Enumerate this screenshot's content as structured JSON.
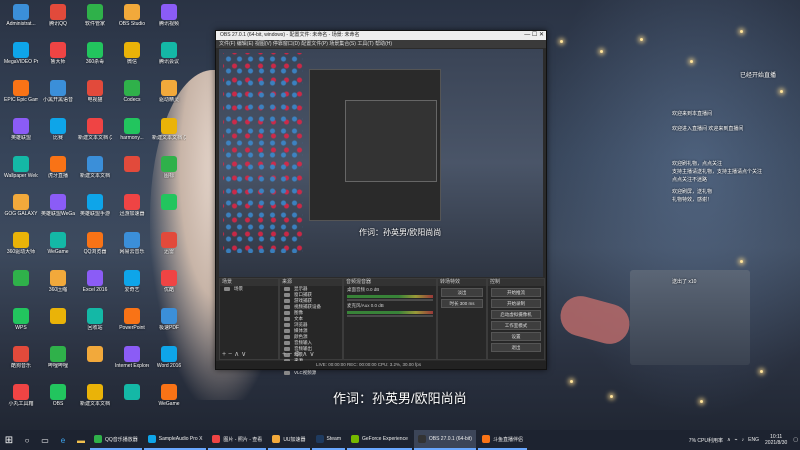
{
  "desktop_icons": [
    "Administrat...",
    "腾讯QQ",
    "软件管家",
    "OBS Studio",
    "腾讯视频",
    "MegaVIDEO Pro",
    "鲁大师",
    "360杀毒",
    "微信",
    "腾讯会议",
    "EPIC Epic Games Launcher",
    "小黑开黑语音",
    "电视猫",
    "Codecs",
    "驱动精灵",
    "英雄联盟",
    "比赛",
    "新建文本文档 (2).txt",
    "harmony...",
    "新建文本文档 (3).txt",
    "Wallpaper Welcome",
    "虎牙直播",
    "新建文本文档",
    "",
    "图标",
    "GOG GALAXY",
    "英雄联盟WeGame",
    "英雄联盟手游",
    "迅游加速器",
    "",
    "360驱动大师",
    "WeGame",
    "QQ浏览器",
    "网易云音乐",
    "迅雷",
    "",
    "360压缩",
    "Excel 2016",
    "爱奇艺",
    "优酷",
    "WPS",
    "",
    "回收站",
    "PowerPoint",
    "极速PDF",
    "酷狗音乐",
    "哔哩哔哩",
    "",
    "Internet Explorer",
    "Word 2016",
    "小丸工具箱",
    "OBS",
    "新建文本文档",
    "",
    "WeGame",
    "WPS Office",
    "迅游",
    "网易UU加速器",
    "",
    "斗鱼直播",
    "红色警戒",
    "Steam",
    "剪映",
    "Unity Connect",
    "斗鱼直播伴侣",
    "新建文件夹",
    "钉钉",
    "新建文件",
    "Launcher",
    "爱奇艺",
    "百度网盘",
    "GameViewer",
    "新建文本文档",
    "新建文本文档"
  ],
  "obs": {
    "title": "OBS 27.0.1 (64-bit, windows) - 配置文件: 未命名 - 场景: 未命名",
    "menu": "文件(F)   编辑(E)   视图(V)   停靠窗口(D)   配置文件(P)   场景集合(S)   工具(T)   帮助(H)",
    "lyric_preview": "作词：孙英男/欧阳尚尚",
    "docks": {
      "scenes": {
        "title": "场景",
        "items": [
          "场景"
        ]
      },
      "sources": {
        "title": "来源",
        "items": [
          "显示器",
          "窗口捕获",
          "游戏捕获",
          "视频捕获设备",
          "图像",
          "文本",
          "浏览器",
          "媒体源",
          "颜色源",
          "音频输入",
          "音频输出",
          "场景",
          "来源",
          "图像幻灯片",
          "VLC视频源"
        ]
      },
      "mixer": {
        "title": "音频混音器",
        "items": [
          "桌面音频 0.0 dB",
          "麦克风/Aux 0.0 dB"
        ]
      },
      "transitions": {
        "title": "转场特效",
        "items": [
          "淡出",
          "时长 300 ms"
        ]
      },
      "controls": {
        "title": "控制",
        "items": [
          "开始推流",
          "开始录制",
          "启动虚拟摄像机",
          "工作室模式",
          "设置",
          "退出"
        ]
      }
    },
    "status": "LIVE: 00:00:00   REC: 00:00:00   CPU: 3.2%, 30.00 fps"
  },
  "right_panel": {
    "header": "已经开始直播",
    "lines": [
      "欢迎来到本直播间",
      "欢迎进入直播间 欢迎来到直播间",
      "欢迎刷礼物，点点关注",
      "支持主播请送礼物，支持主播请点个关注",
      "点点关注不迷路",
      "欢迎刷屏，送礼物",
      "礼物特效，感谢！",
      "送出了 x10"
    ]
  },
  "lyric": "作词：孙英男/欧阳尚尚",
  "taskbar": {
    "apps": [
      "QQ音乐播放器",
      "SampleAudio Pro X",
      "图片 - 照片 - 查看",
      "UU加速器",
      "Steam",
      "GeForce Experience",
      "OBS 27.0.1 (64-bit)",
      "斗鱼直播伴侣"
    ],
    "tray": {
      "cpu": "7% CPU利用率",
      "lang": "ENG",
      "time": "10:11",
      "date": "2021/8/30"
    }
  },
  "colors": {
    "accent": "#6aa8ff",
    "obs_bg": "#2b2b2b"
  }
}
